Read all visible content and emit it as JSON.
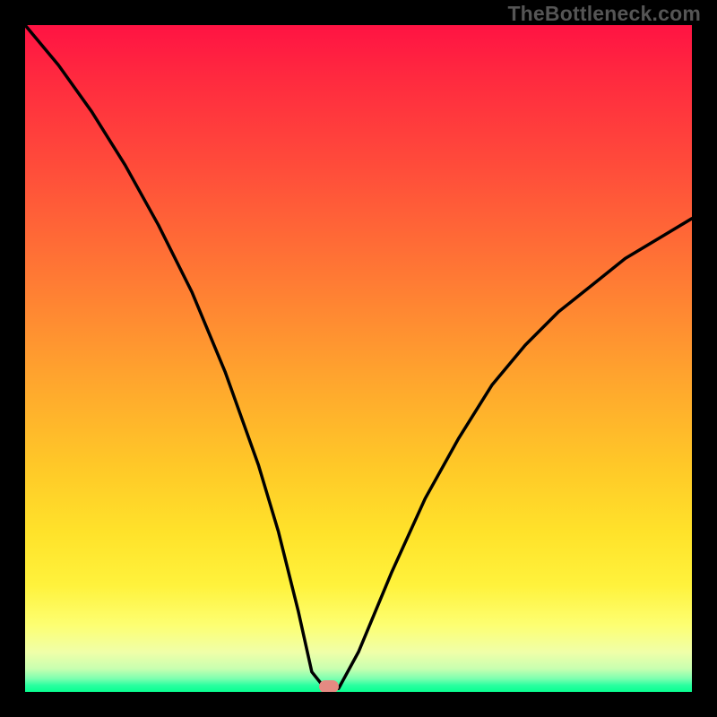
{
  "watermark": "TheBottleneck.com",
  "colors": {
    "frame_bg": "#000000",
    "curve_stroke": "#000000",
    "marker_fill": "#e58a82",
    "gradient_stops": [
      {
        "pos": 0.0,
        "hex": "#ff1343"
      },
      {
        "pos": 0.08,
        "hex": "#ff2a3f"
      },
      {
        "pos": 0.22,
        "hex": "#ff4e3a"
      },
      {
        "pos": 0.38,
        "hex": "#ff7a34"
      },
      {
        "pos": 0.52,
        "hex": "#ffa22e"
      },
      {
        "pos": 0.66,
        "hex": "#ffc828"
      },
      {
        "pos": 0.76,
        "hex": "#ffe22a"
      },
      {
        "pos": 0.84,
        "hex": "#fff23c"
      },
      {
        "pos": 0.9,
        "hex": "#fdff72"
      },
      {
        "pos": 0.94,
        "hex": "#f0ffa8"
      },
      {
        "pos": 0.965,
        "hex": "#c9ffb0"
      },
      {
        "pos": 0.98,
        "hex": "#7dffb0"
      },
      {
        "pos": 0.99,
        "hex": "#2bffa0"
      },
      {
        "pos": 1.0,
        "hex": "#08ff90"
      }
    ]
  },
  "chart_data": {
    "type": "line",
    "title": "",
    "xlabel": "",
    "ylabel": "",
    "xlim": [
      0,
      1
    ],
    "ylim": [
      0,
      1
    ],
    "note": "Axes are unlabeled; x and y are normalized to plot area. y=1 is top of plot (red), y=0 bottom (green). Curve is a V-shaped bottleneck with minimum near x≈0.45.",
    "series": [
      {
        "name": "bottleneck-curve",
        "x": [
          0.0,
          0.05,
          0.1,
          0.15,
          0.2,
          0.25,
          0.3,
          0.35,
          0.38,
          0.41,
          0.43,
          0.45,
          0.47,
          0.5,
          0.55,
          0.6,
          0.65,
          0.7,
          0.75,
          0.8,
          0.85,
          0.9,
          0.95,
          1.0
        ],
        "y": [
          1.0,
          0.94,
          0.87,
          0.79,
          0.7,
          0.6,
          0.48,
          0.34,
          0.24,
          0.12,
          0.03,
          0.005,
          0.005,
          0.06,
          0.18,
          0.29,
          0.38,
          0.46,
          0.52,
          0.57,
          0.61,
          0.65,
          0.68,
          0.71
        ]
      }
    ],
    "marker": {
      "x": 0.455,
      "y": 0.008
    }
  }
}
